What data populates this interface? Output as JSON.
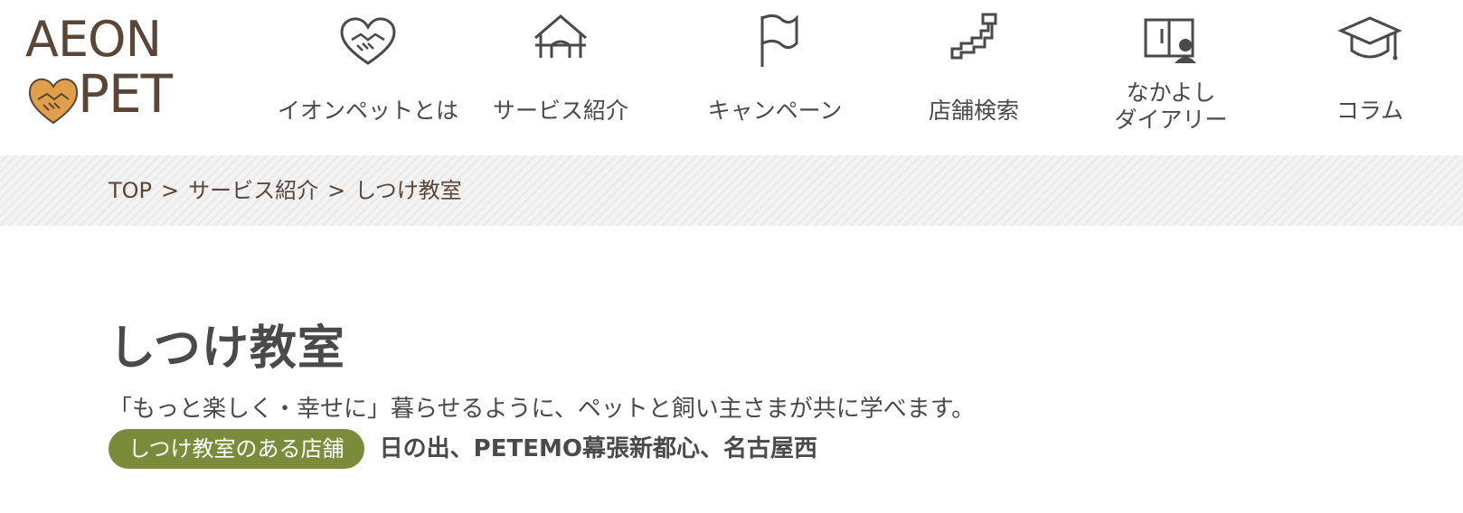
{
  "header": {
    "logo": {
      "line1": "AEON",
      "line2": "PET",
      "heart_color": "#e0a04a"
    },
    "nav": [
      {
        "label": "イオンペットとは",
        "icon": "handshake-heart-icon"
      },
      {
        "label": "サービス紹介",
        "icon": "house-icon"
      },
      {
        "label": "キャンペーン",
        "icon": "flag-icon"
      },
      {
        "label": "店舗検索",
        "icon": "japan-map-icon"
      },
      {
        "label": "なかよし\nダイアリー",
        "icon": "diary-book-icon"
      },
      {
        "label": "コラム",
        "icon": "mortarboard-icon"
      }
    ]
  },
  "breadcrumb": {
    "items": [
      "TOP",
      "サービス紹介",
      "しつけ教室"
    ],
    "separator": ">"
  },
  "main": {
    "title": "しつけ教室",
    "subtitle": "「もっと楽しく・幸せに」暮らせるように、ペットと飼い主さまが共に学べます。",
    "store_badge": "しつけ教室のある店舗",
    "store_list": "日の出、PETEMO幕張新都心、名古屋西"
  },
  "colors": {
    "text": "#4a4a4a",
    "brand_brown": "#5a4637",
    "badge_green": "#7a8c3a"
  }
}
